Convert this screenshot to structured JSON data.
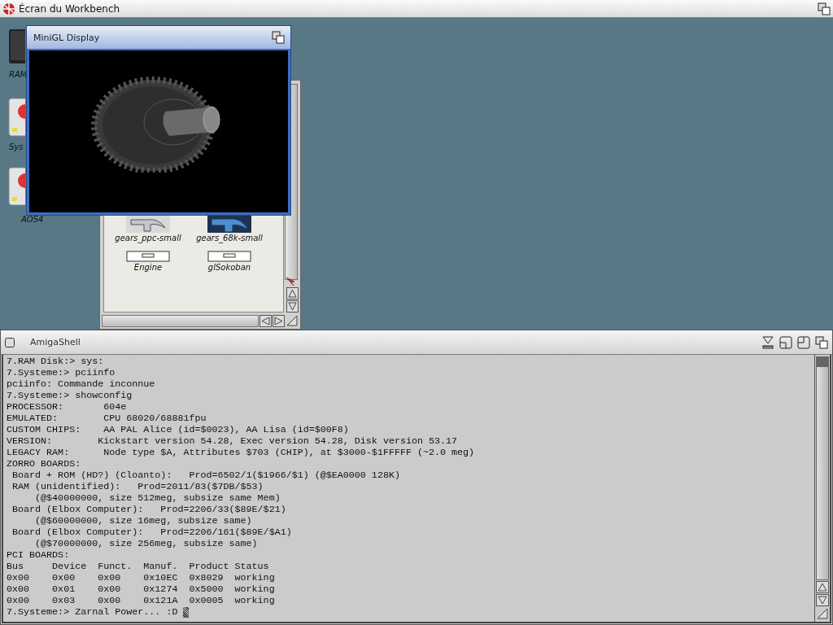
{
  "screen": {
    "title": "Écran du Workbench"
  },
  "desktop_icons": [
    {
      "label": "RAM",
      "kind": "ram"
    },
    {
      "label": "Sys",
      "kind": "disk"
    },
    {
      "label": "AOS4",
      "kind": "disk"
    }
  ],
  "drawer": {
    "icons": [
      {
        "label": "gears_ppc-small",
        "kind": "tool",
        "selected": false
      },
      {
        "label": "gears_68k-small",
        "kind": "tool",
        "selected": true
      },
      {
        "label": "Engine",
        "kind": "app",
        "selected": false
      },
      {
        "label": "glSokoban",
        "kind": "app",
        "selected": false
      }
    ]
  },
  "gl_window": {
    "title": "MiniGL Display"
  },
  "shell": {
    "title": "AmigaShell",
    "lines": [
      "7.RAM Disk:> sys:",
      "7.Systeme:> pciinfo",
      "pciinfo: Commande inconnue",
      "7.Systeme:> showconfig",
      "PROCESSOR:       604e",
      "EMULATED:        CPU 68020/68881fpu",
      "CUSTOM CHIPS:    AA PAL Alice (id=$0023), AA Lisa (id=$00F8)",
      "VERSION:        Kickstart version 54.28, Exec version 54.28, Disk version 53.17",
      "LEGACY RAM:      Node type $A, Attributes $703 (CHIP), at $3000-$1FFFFF (~2.0 meg)",
      "ZORRO BOARDS:",
      " Board + ROM (HD?) (Cloanto):   Prod=6502/1($1966/$1) (@$EA0000 128K)",
      " RAM (unidentified):   Prod=2011/83($7DB/$53)",
      "     (@$40000000, size 512meg, subsize same Mem)",
      " Board (Elbox Computer):   Prod=2206/33($89E/$21)",
      "     (@$60000000, size 16meg, subsize same)",
      " Board (Elbox Computer):   Prod=2206/161($89E/$A1)",
      "     (@$70000000, size 256meg, subsize same)",
      "PCI BOARDS:",
      "Bus     Device  Funct.  Manuf.  Product Status",
      "0x00    0x00    0x00    0x10EC  0x8029  working",
      "0x00    0x01    0x00    0x1274  0x5000  working",
      "0x00    0x03    0x00    0x121A  0x0005  working"
    ],
    "prompt": "7.Systeme:> Zarnal Power... :D"
  }
}
